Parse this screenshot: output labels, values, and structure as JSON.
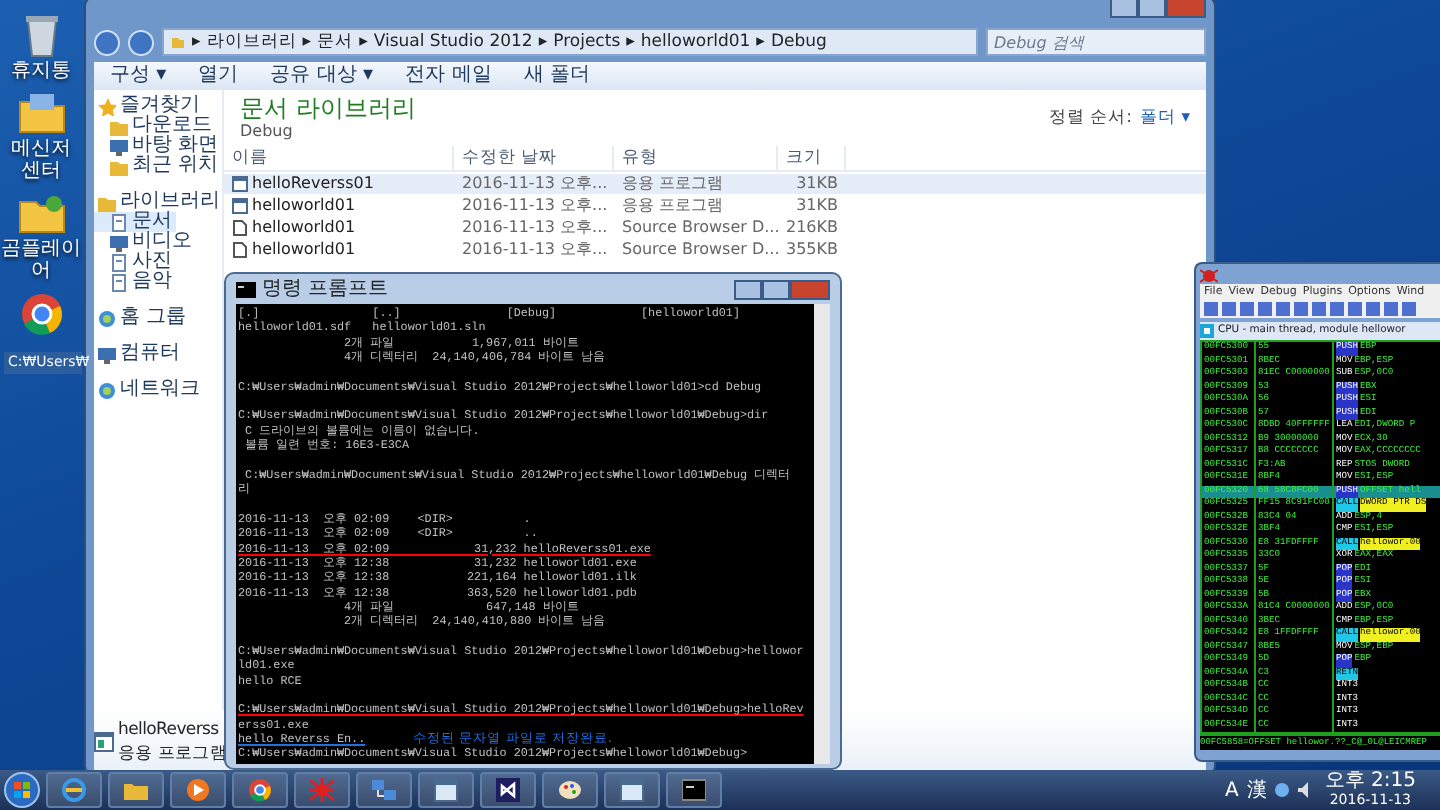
{
  "desktop_icons": [
    {
      "label": "휴지통",
      "kind": "bin"
    },
    {
      "label": "메신저 센터",
      "kind": "folder"
    },
    {
      "label": "곰플레이어",
      "kind": "player"
    },
    {
      "kind": "chrome"
    }
  ],
  "background_window": {
    "title": "C:₩Users₩"
  },
  "explorer": {
    "address": [
      {
        "arrow": "▸",
        "label": "라이브러리"
      },
      {
        "arrow": "▸",
        "label": "문서"
      },
      {
        "arrow": "▸",
        "label": "Visual Studio 2012"
      },
      {
        "arrow": "▸",
        "label": "Projects"
      },
      {
        "arrow": "▸",
        "label": "helloworld01"
      },
      {
        "arrow": "▸",
        "label": "Debug"
      }
    ],
    "search": {
      "placeholder": "Debug 검색"
    },
    "toolbar": [
      "구성 ▾",
      "열기",
      "공유 대상 ▾",
      "전자 메일",
      "새 폴더"
    ],
    "sidebar": [
      {
        "label": "즐겨찾기",
        "kind": "star",
        "selected": false,
        "children": [
          {
            "label": "다운로드",
            "kind": "folder",
            "selected": false
          },
          {
            "label": "바탕 화면",
            "kind": "screen",
            "selected": false
          },
          {
            "label": "최근 위치",
            "kind": "folder",
            "selected": false
          }
        ]
      },
      {
        "label": "라이브러리",
        "kind": "folder",
        "selected": false,
        "children": [
          {
            "label": "문서",
            "kind": "doc",
            "selected": true
          },
          {
            "label": "비디오",
            "kind": "screen",
            "selected": false
          },
          {
            "label": "사진",
            "kind": "doc",
            "selected": false
          },
          {
            "label": "음악",
            "kind": "doc",
            "selected": false
          }
        ]
      },
      {
        "label": "홈 그룹",
        "kind": "home",
        "selected": false
      },
      {
        "label": "컴퓨터",
        "kind": "screen",
        "selected": false
      },
      {
        "label": "네트워크",
        "kind": "home",
        "selected": false
      }
    ],
    "heading": "문서 라이브러리",
    "subheading": "Debug",
    "sort_label": "정렬 순서:",
    "sort_value": "폴더 ▾",
    "columns": [
      "이름",
      "수정한 날짜",
      "유형",
      "크기"
    ],
    "files": [
      {
        "name": "helloReverss01",
        "date": "2016-11-13 오후...",
        "type": "응용 프로그램",
        "size": "31KB",
        "kind": "exe",
        "selected": true
      },
      {
        "name": "helloworld01",
        "date": "2016-11-13 오후...",
        "type": "응용 프로그램",
        "size": "31KB",
        "kind": "exe",
        "selected": false
      },
      {
        "name": "helloworld01",
        "date": "2016-11-13 오후...",
        "type": "Source Browser D...",
        "size": "216KB",
        "kind": "file",
        "selected": false
      },
      {
        "name": "helloworld01",
        "date": "2016-11-13 오후...",
        "type": "Source Browser D...",
        "size": "355KB",
        "kind": "file",
        "selected": false
      }
    ],
    "details": {
      "name": "helloReverss",
      "type": "응용 프로그램"
    }
  },
  "console": {
    "title": "명령 프롬프트",
    "lines": [
      {
        "kind": "text",
        "text": "[.]                [..]               [Debug]            [helloworld01]"
      },
      {
        "kind": "text",
        "text": "helloworld01.sdf   helloworld01.sln"
      },
      {
        "kind": "text",
        "text": "               2개 파일           1,967,011 바이트"
      },
      {
        "kind": "text",
        "text": "               4개 디렉터리  24,140,406,784 바이트 남음"
      },
      {
        "kind": "blank"
      },
      {
        "kind": "text",
        "text": "C:₩Users₩admin₩Documents₩Visual Studio 2012₩Projects₩helloworld01>cd Debug"
      },
      {
        "kind": "blank"
      },
      {
        "kind": "text",
        "text": "C:₩Users₩admin₩Documents₩Visual Studio 2012₩Projects₩helloworld01₩Debug>dir"
      },
      {
        "kind": "text",
        "text": " C 드라이브의 볼륨에는 이름이 없습니다."
      },
      {
        "kind": "text",
        "text": " 볼륨 일련 번호: 16E3-E3CA"
      },
      {
        "kind": "blank"
      },
      {
        "kind": "text",
        "text": " C:₩Users₩admin₩Documents₩Visual Studio 2012₩Projects₩helloworld01₩Debug 디렉터"
      },
      {
        "kind": "text",
        "text": "리"
      },
      {
        "kind": "blank"
      },
      {
        "kind": "text",
        "text": "2016-11-13  오후 02:09    <DIR>          ."
      },
      {
        "kind": "text",
        "text": "2016-11-13  오후 02:09    <DIR>          .."
      },
      {
        "kind": "text",
        "text": "2016-11-13  오후 02:09            31,232 helloReverss01.exe",
        "color": "#ff0000"
      },
      {
        "kind": "text",
        "text": "2016-11-13  오후 12:38            31,232 helloworld01.exe"
      },
      {
        "kind": "text",
        "text": "2016-11-13  오후 12:38           221,164 helloworld01.ilk"
      },
      {
        "kind": "text",
        "text": "2016-11-13  오후 12:38           363,520 helloworld01.pdb"
      },
      {
        "kind": "text",
        "text": "               4개 파일             647,148 바이트"
      },
      {
        "kind": "text",
        "text": "               2개 디렉터리  24,140,410,880 바이트 남음"
      },
      {
        "kind": "blank"
      },
      {
        "kind": "text",
        "text": "C:₩Users₩admin₩Documents₩Visual Studio 2012₩Projects₩helloworld01₩Debug>hellowor"
      },
      {
        "kind": "text",
        "text": "ld01.exe"
      },
      {
        "kind": "text",
        "text": "hello RCE"
      },
      {
        "kind": "blank"
      },
      {
        "kind": "text",
        "text": "C:₩Users₩admin₩Documents₩Visual Studio 2012₩Projects₩helloworld01₩Debug>helloRev",
        "color": "#ff0000"
      },
      {
        "kind": "text",
        "text": "erss01.exe"
      },
      {
        "kind": "text",
        "text": "hello Reverss En..",
        "color": "#1e6fe0",
        "note": "수정된 문자열 파일로 저장완료."
      },
      {
        "kind": "text",
        "text": "C:₩Users₩admin₩Documents₩Visual Studio 2012₩Projects₩helloworld01₩Debug>"
      }
    ]
  },
  "debugger": {
    "menu": [
      "File",
      "View",
      "Debug",
      "Plugins",
      "Options",
      "Wind"
    ],
    "pane_title": "CPU - main thread, module hellowor",
    "rows": [
      {
        "address": "00FC5300",
        "hex": "55",
        "mnemonic": "PUSH",
        "operand": "EBP",
        "kind": "stack",
        "selected": false
      },
      {
        "address": "00FC5301",
        "hex": "8BEC",
        "mnemonic": "MOV",
        "operand": "EBP,ESP",
        "kind": "plain",
        "selected": false
      },
      {
        "address": "00FC5303",
        "hex": "81EC C0000000",
        "mnemonic": "SUB",
        "operand": "ESP,0C0",
        "kind": "plain",
        "selected": false
      },
      {
        "address": "00FC5309",
        "hex": "53",
        "mnemonic": "PUSH",
        "operand": "EBX",
        "kind": "stack",
        "selected": false
      },
      {
        "address": "00FC530A",
        "hex": "56",
        "mnemonic": "PUSH",
        "operand": "ESI",
        "kind": "stack",
        "selected": false
      },
      {
        "address": "00FC530B",
        "hex": "57",
        "mnemonic": "PUSH",
        "operand": "EDI",
        "kind": "stack",
        "selected": false
      },
      {
        "address": "00FC530C",
        "hex": "8DBD 40FFFFFF",
        "mnemonic": "LEA",
        "operand": "EDI,DWORD P",
        "kind": "plain",
        "selected": false
      },
      {
        "address": "00FC5312",
        "hex": "B9 30000000",
        "mnemonic": "MOV",
        "operand": "ECX,30",
        "kind": "plain",
        "selected": false
      },
      {
        "address": "00FC5317",
        "hex": "B8 CCCCCCCC",
        "mnemonic": "MOV",
        "operand": "EAX,CCCCCCCC",
        "kind": "plain",
        "selected": false
      },
      {
        "address": "00FC531C",
        "hex": "F3:AB",
        "mnemonic": "REP",
        "operand": "STOS DWORD",
        "kind": "plain",
        "selected": false
      },
      {
        "address": "00FC531E",
        "hex": "8BF4",
        "mnemonic": "MOV",
        "operand": "ESI,ESP",
        "kind": "plain",
        "selected": false
      },
      {
        "address": "00FC5320",
        "hex": "68 58C8FC00",
        "mnemonic": "PUSH",
        "operand": "OFFSET hell",
        "kind": "stack",
        "selected": true
      },
      {
        "address": "00FC5325",
        "hex": "FF15 8C91FC00",
        "mnemonic": "CALL",
        "operand": "DWORD PTR DS",
        "kind": "call",
        "selected": false
      },
      {
        "address": "00FC532B",
        "hex": "83C4 04",
        "mnemonic": "ADD",
        "operand": "ESP,4",
        "kind": "plain",
        "selected": false
      },
      {
        "address": "00FC532E",
        "hex": "3BF4",
        "mnemonic": "CMP",
        "operand": "ESI,ESP",
        "kind": "plain",
        "selected": false
      },
      {
        "address": "00FC5330",
        "hex": "E8 31FDFFFF",
        "mnemonic": "CALL",
        "operand": "hellowor.00",
        "kind": "call",
        "selected": false
      },
      {
        "address": "00FC5335",
        "hex": "33C0",
        "mnemonic": "XOR",
        "operand": "EAX,EAX",
        "kind": "plain",
        "selected": false
      },
      {
        "address": "00FC5337",
        "hex": "5F",
        "mnemonic": "POP",
        "operand": "EDI",
        "kind": "stack",
        "selected": false
      },
      {
        "address": "00FC5338",
        "hex": "5E",
        "mnemonic": "POP",
        "operand": "ESI",
        "kind": "stack",
        "selected": false
      },
      {
        "address": "00FC5339",
        "hex": "5B",
        "mnemonic": "POP",
        "operand": "EBX",
        "kind": "stack",
        "selected": false
      },
      {
        "address": "00FC533A",
        "hex": "81C4 C0000000",
        "mnemonic": "ADD",
        "operand": "ESP,0C0",
        "kind": "plain",
        "selected": false
      },
      {
        "address": "00FC5340",
        "hex": "3BEC",
        "mnemonic": "CMP",
        "operand": "EBP,ESP",
        "kind": "plain",
        "selected": false
      },
      {
        "address": "00FC5342",
        "hex": "E8 1FFDFFFF",
        "mnemonic": "CALL",
        "operand": "hellowor.00",
        "kind": "call",
        "selected": false
      },
      {
        "address": "00FC5347",
        "hex": "8BE5",
        "mnemonic": "MOV",
        "operand": "ESP,EBP",
        "kind": "plain",
        "selected": false
      },
      {
        "address": "00FC5349",
        "hex": "5D",
        "mnemonic": "POP",
        "operand": "EBP",
        "kind": "stack",
        "selected": false
      },
      {
        "address": "00FC534A",
        "hex": "C3",
        "mnemonic": "RETN",
        "kind": "ret",
        "selected": false
      },
      {
        "address": "00FC534B",
        "hex": "CC",
        "mnemonic": "INT3",
        "kind": "plain",
        "selected": false
      },
      {
        "address": "00FC534C",
        "hex": "CC",
        "mnemonic": "INT3",
        "kind": "plain",
        "selected": false
      },
      {
        "address": "00FC534D",
        "hex": "CC",
        "mnemonic": "INT3",
        "kind": "plain",
        "selected": false
      },
      {
        "address": "00FC534E",
        "hex": "CC",
        "mnemonic": "INT3",
        "kind": "plain",
        "selected": false
      }
    ],
    "status": "00FC5858=OFFSET hellowor.??_C@_0L@LEICMREP"
  },
  "taskbar": {
    "apps": [
      {
        "kind": "ie"
      },
      {
        "kind": "folder"
      },
      {
        "kind": "media"
      },
      {
        "kind": "chrome"
      },
      {
        "kind": "bug"
      },
      {
        "kind": "network"
      },
      {
        "kind": "window"
      },
      {
        "kind": "vs"
      },
      {
        "kind": "paint"
      },
      {
        "kind": "window"
      },
      {
        "kind": "console"
      }
    ],
    "language": [
      "A",
      "漢"
    ],
    "time": "오후 2:15",
    "date": "2016-11-13"
  }
}
